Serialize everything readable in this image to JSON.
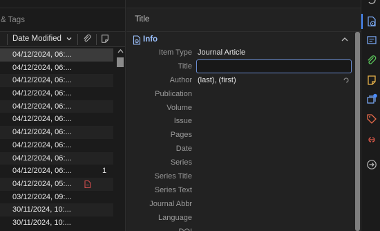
{
  "left_pane": {
    "tags_header": "& Tags",
    "column_header": {
      "sort_label": "Date Modified"
    },
    "rows": [
      {
        "date": "04/12/2024, 06:...",
        "count": "",
        "has_pdf": false,
        "selected": true
      },
      {
        "date": "04/12/2024, 06:...",
        "count": "",
        "has_pdf": false,
        "selected": false
      },
      {
        "date": "04/12/2024, 06:...",
        "count": "",
        "has_pdf": false,
        "selected": false
      },
      {
        "date": "04/12/2024, 06:...",
        "count": "",
        "has_pdf": false,
        "selected": false
      },
      {
        "date": "04/12/2024, 06:...",
        "count": "",
        "has_pdf": false,
        "selected": false
      },
      {
        "date": "04/12/2024, 06:...",
        "count": "",
        "has_pdf": false,
        "selected": false
      },
      {
        "date": "04/12/2024, 06:...",
        "count": "",
        "has_pdf": false,
        "selected": false
      },
      {
        "date": "04/12/2024, 06:...",
        "count": "",
        "has_pdf": false,
        "selected": false
      },
      {
        "date": "04/12/2024, 06:...",
        "count": "",
        "has_pdf": false,
        "selected": false
      },
      {
        "date": "04/12/2024, 06:...",
        "count": "1",
        "has_pdf": false,
        "selected": false
      },
      {
        "date": "04/12/2024, 05:...",
        "count": "",
        "has_pdf": true,
        "selected": false
      },
      {
        "date": "03/12/2024, 09:...",
        "count": "",
        "has_pdf": false,
        "selected": false
      },
      {
        "date": "30/11/2024, 10:...",
        "count": "",
        "has_pdf": false,
        "selected": false
      },
      {
        "date": "30/11/2024, 10:...",
        "count": "",
        "has_pdf": false,
        "selected": false
      }
    ]
  },
  "item_pane": {
    "header_title": "Title",
    "section_label": "Info",
    "fields": [
      {
        "label": "Item Type",
        "value": "Journal Article"
      },
      {
        "label": "Title",
        "value": ""
      },
      {
        "label": "Author",
        "value": "(last),  (first)"
      },
      {
        "label": "Publication",
        "value": ""
      },
      {
        "label": "Volume",
        "value": ""
      },
      {
        "label": "Issue",
        "value": ""
      },
      {
        "label": "Pages",
        "value": ""
      },
      {
        "label": "Date",
        "value": ""
      },
      {
        "label": "Series",
        "value": ""
      },
      {
        "label": "Series Title",
        "value": ""
      },
      {
        "label": "Series Text",
        "value": ""
      },
      {
        "label": "Journal Abbr",
        "value": ""
      },
      {
        "label": "Language",
        "value": ""
      },
      {
        "label": "DOI",
        "value": ""
      }
    ]
  },
  "side_toolbar": {
    "icons": [
      "info-icon",
      "abstract-icon",
      "attachments-icon",
      "notes-icon",
      "libraries-collections-icon",
      "tags-icon",
      "related-icon",
      "locate-icon"
    ]
  },
  "colors": {
    "accent": "#4a8cff",
    "section_label": "#9cc2ff",
    "notes_icon": "#e8b34a",
    "tags_icon": "#e86b4a",
    "related_icon": "#e05a4a",
    "attachments_icon": "#5cc85c",
    "pdf_icon": "#e05050"
  }
}
